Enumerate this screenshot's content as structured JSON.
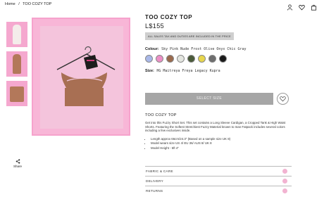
{
  "breadcrumb": {
    "home": "Home",
    "separator": "/",
    "current": "TOO COZY TOP"
  },
  "header_icons": [
    "user-icon",
    "heart-icon",
    "bag-icon"
  ],
  "gallery": {
    "thumbnail_count": 3,
    "share_label": "Share"
  },
  "product": {
    "title": "TOO COZY TOP",
    "price": "L$155",
    "tax_note": "ALL SALES TAX AND DUTIES ARE INCLUDED IN THE PRICE",
    "colour_label": "Colour:",
    "colour_options": "Sky Pink Nude Frost Olive Onyx Chic Gray",
    "swatches": [
      {
        "name": "Sky",
        "color": "#a9b8e8"
      },
      {
        "name": "Pink",
        "color": "#ec8fc6"
      },
      {
        "name": "Nude",
        "color": "#9a6a4d"
      },
      {
        "name": "Frost",
        "color": "#e4e6e0"
      },
      {
        "name": "Olive",
        "color": "#4a5a3a"
      },
      {
        "name": "Onyx",
        "color": "#e7d64d"
      },
      {
        "name": "Chic",
        "color": "#6e6e6e"
      },
      {
        "name": "Gray",
        "color": "#1a1a1a"
      }
    ],
    "size_label": "Size:",
    "size_options": "HG Maitreya Freya Legacy Kupra",
    "select_size_label": "SELECT SIZE"
  },
  "description": {
    "title": "TOO COZY TOP",
    "text": "Get into this Fuzzy Short Set. This set contains a Long Sleeve Cardigan, a Cropped Tank & High Waist Shorts. Featuring the Softest Stretchiest Fuzzy Material known to man Fatpack includes several colors including a few exclusives inside.",
    "bullets": [
      "Length approx 66cm/24.3\" (Based on a sample size UK 8)",
      "Model wears size US 4/ EU 36/ AUS 8/ UK 8",
      "Model Height - 5ft 4\""
    ]
  },
  "accordions": [
    {
      "label": "FABRIC & CARE"
    },
    {
      "label": "DELIVERY"
    },
    {
      "label": "RETURNS"
    }
  ],
  "colors": {
    "accent_pink": "#f2b3d1",
    "button_gray": "#a6a6a6"
  }
}
